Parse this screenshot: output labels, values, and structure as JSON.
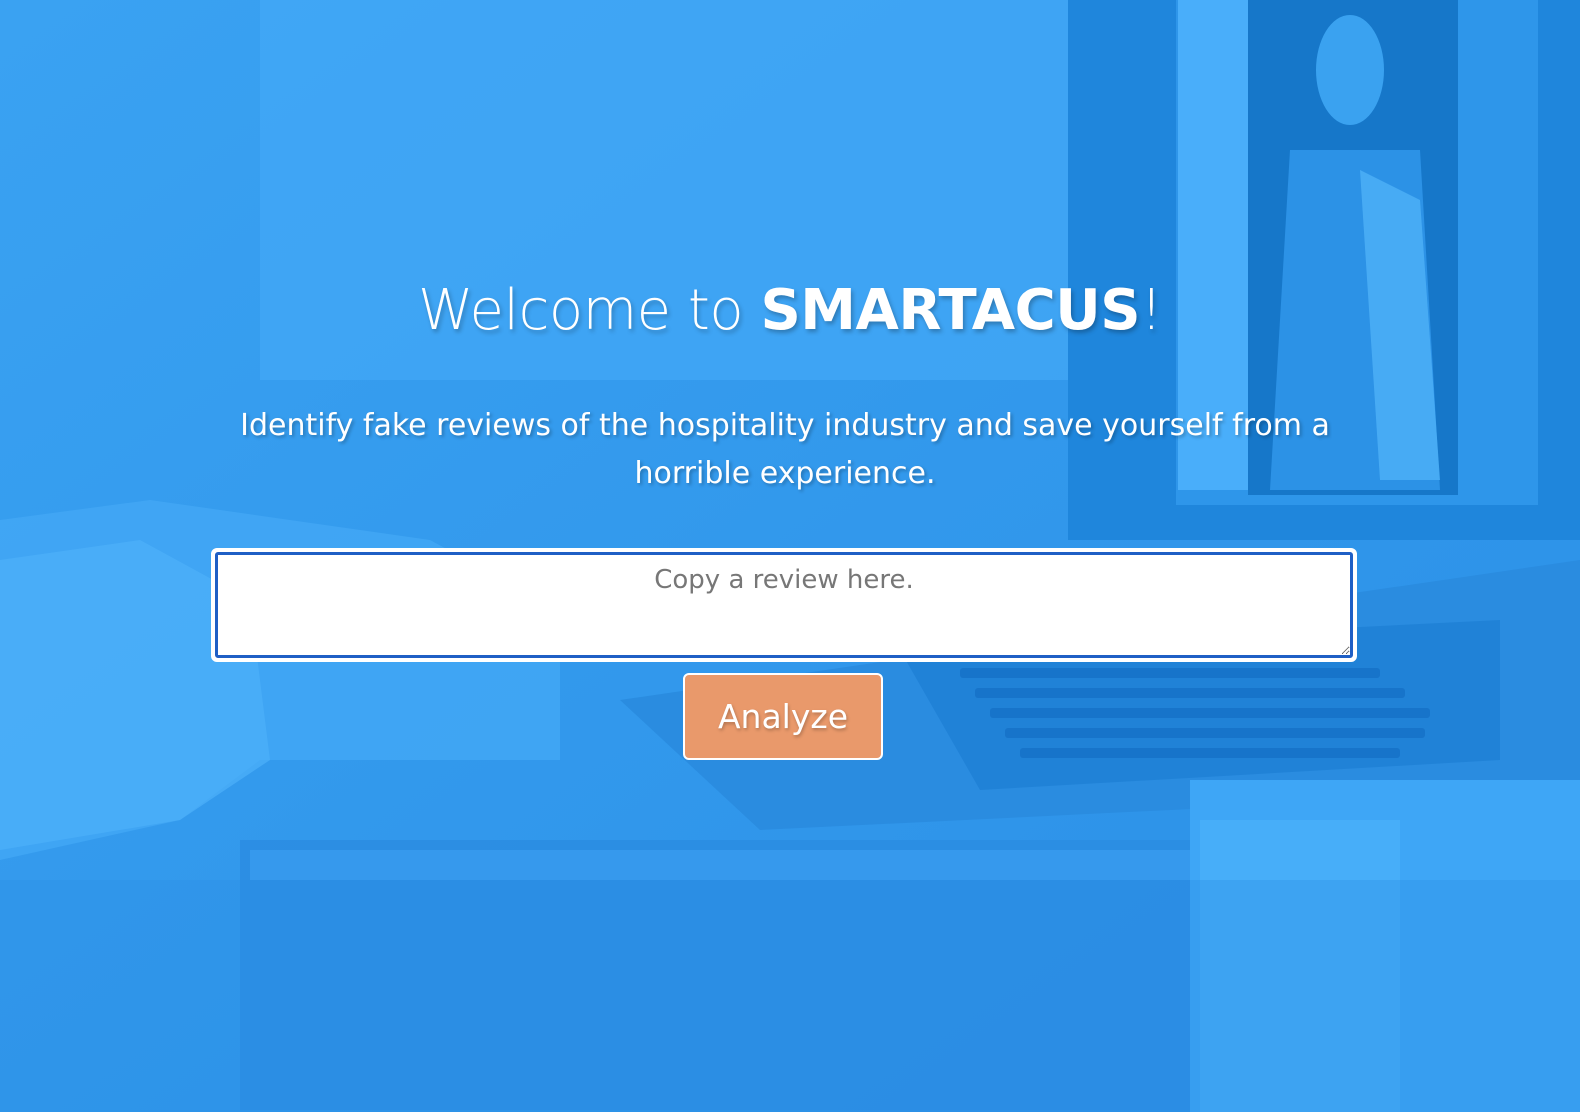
{
  "hero": {
    "title_prefix": "Welcome to ",
    "brand": "SMARTACUS",
    "title_suffix": "!",
    "subtitle": "Identify fake reviews of the hospitality industry and save yourself from a horrible experience."
  },
  "review_input": {
    "placeholder": "Copy a review here.",
    "value": ""
  },
  "actions": {
    "analyze_label": "Analyze"
  },
  "colors": {
    "background_overlay": "#2f97ec",
    "input_border": "#1f5fc5",
    "button": "#e9996b"
  }
}
